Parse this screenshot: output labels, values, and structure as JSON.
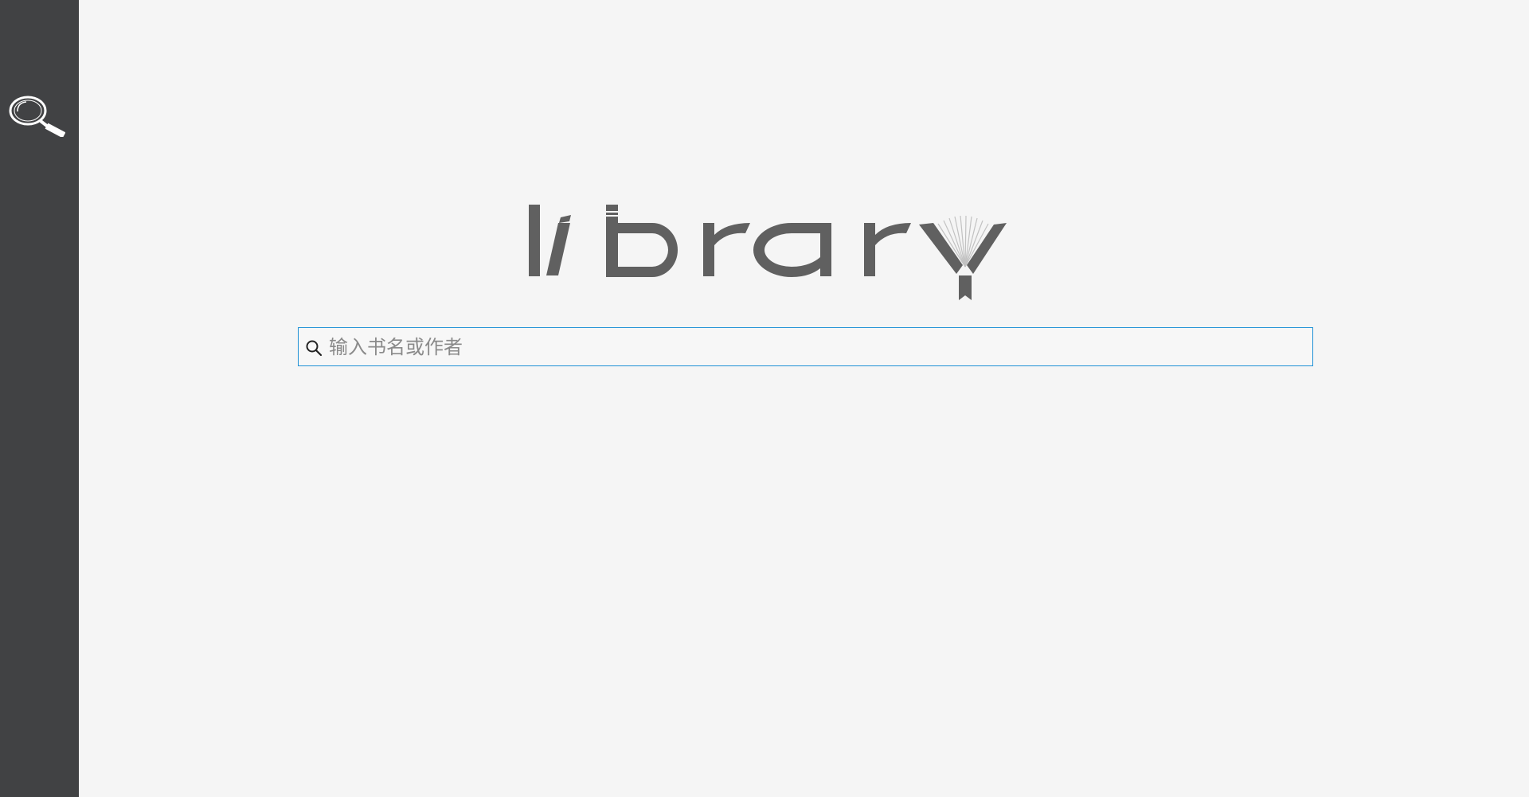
{
  "sidebar": {
    "search_icon": "magnifier-icon"
  },
  "logo": {
    "text": "library",
    "color": "#606060"
  },
  "search": {
    "placeholder": "输入书名或作者",
    "value": "",
    "icon": "search-icon",
    "border_color": "#1e90d6"
  },
  "colors": {
    "sidebar_bg": "#414244",
    "page_bg": "#f5f5f5"
  }
}
